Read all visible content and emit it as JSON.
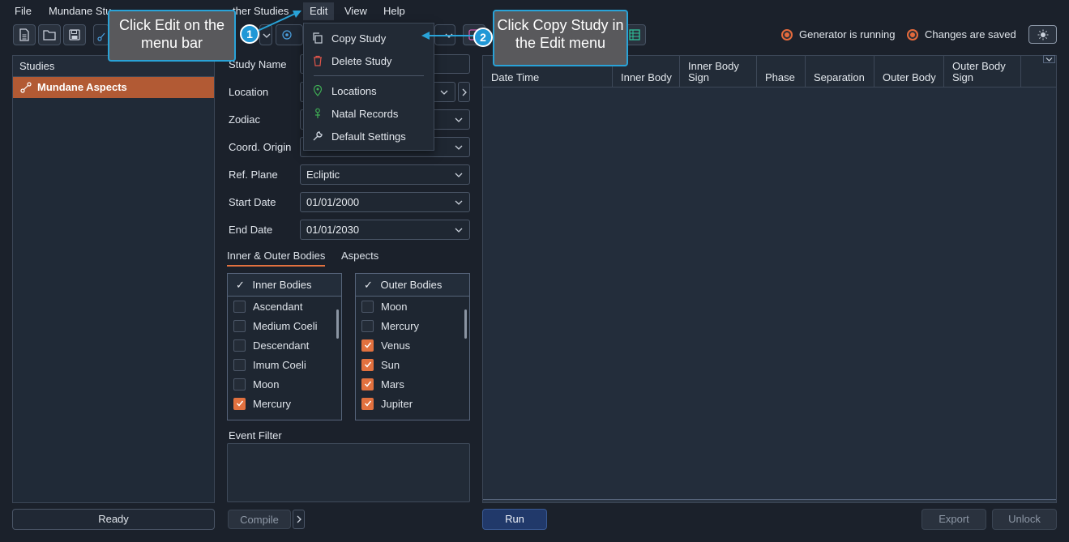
{
  "menubar": {
    "file": "File",
    "mundane": "Mundane Stu",
    "other": "ther Studies",
    "edit": "Edit",
    "view": "View",
    "help": "Help"
  },
  "status": {
    "generator": "Generator is running",
    "saved": "Changes are saved"
  },
  "studies": {
    "header": "Studies",
    "items": [
      "Mundane Aspects"
    ]
  },
  "form": {
    "study_name": "Study Name",
    "location": "Location",
    "zodiac": "Zodiac",
    "coord_origin": "Coord. Origin",
    "ref_plane": "Ref. Plane",
    "ref_plane_value": "Ecliptic",
    "start_date": "Start Date",
    "start_date_value": "01/01/2000",
    "end_date": "End Date",
    "end_date_value": "01/01/2030"
  },
  "tabs": {
    "bodies": "Inner & Outer Bodies",
    "aspects": "Aspects"
  },
  "inner": {
    "header": "Inner Bodies",
    "rows": [
      {
        "label": "Ascendant",
        "checked": false
      },
      {
        "label": "Medium Coeli",
        "checked": false
      },
      {
        "label": "Descendant",
        "checked": false
      },
      {
        "label": "Imum Coeli",
        "checked": false
      },
      {
        "label": "Moon",
        "checked": false
      },
      {
        "label": "Mercury",
        "checked": true
      }
    ]
  },
  "outer": {
    "header": "Outer Bodies",
    "rows": [
      {
        "label": "Moon",
        "checked": false
      },
      {
        "label": "Mercury",
        "checked": false
      },
      {
        "label": "Venus",
        "checked": true
      },
      {
        "label": "Sun",
        "checked": true
      },
      {
        "label": "Mars",
        "checked": true
      },
      {
        "label": "Jupiter",
        "checked": true
      }
    ]
  },
  "event_filter": "Event Filter",
  "buttons": {
    "ready": "Ready",
    "compile": "Compile",
    "run": "Run",
    "export": "Export",
    "unlock": "Unlock"
  },
  "table": {
    "cols": [
      "Date Time",
      "Inner Body",
      "Inner Body Sign",
      "Phase",
      "Separation",
      "Outer Body",
      "Outer Body Sign"
    ]
  },
  "dropdown": {
    "copy": "Copy Study",
    "delete": "Delete Study",
    "locations": "Locations",
    "natal": "Natal Records",
    "defaults": "Default Settings"
  },
  "callouts": {
    "c1": "Click Edit on the menu bar",
    "c2": "Click Copy Study in the Edit menu",
    "n1": "1",
    "n2": "2"
  },
  "colors": {
    "accent": "#e2713f",
    "callout_border": "#29a3d8",
    "selected_study": "#b25a34"
  }
}
